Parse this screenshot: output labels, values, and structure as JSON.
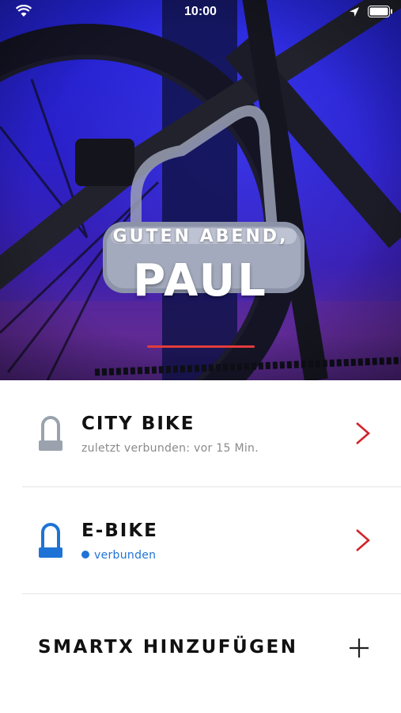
{
  "status_bar": {
    "time": "10:00"
  },
  "hero": {
    "greeting": "GUTEN ABEND,",
    "name": "PAUL"
  },
  "devices": [
    {
      "name": "CITY BIKE",
      "status": "zuletzt verbunden: vor 15 Min.",
      "connected": false
    },
    {
      "name": "E-BIKE",
      "status": "verbunden",
      "connected": true
    }
  ],
  "add_device": {
    "label": "SMARTX HINZUFÜGEN"
  },
  "colors": {
    "accent_red": "#d2232a",
    "connected_blue": "#1f73d6",
    "lock_gray": "#9aa3ad",
    "hero_blue": "#2323d8"
  },
  "icons": [
    "wifi-icon",
    "location-arrow-icon",
    "battery-icon",
    "u-lock-icon",
    "chevron-right-icon",
    "plus-icon"
  ]
}
